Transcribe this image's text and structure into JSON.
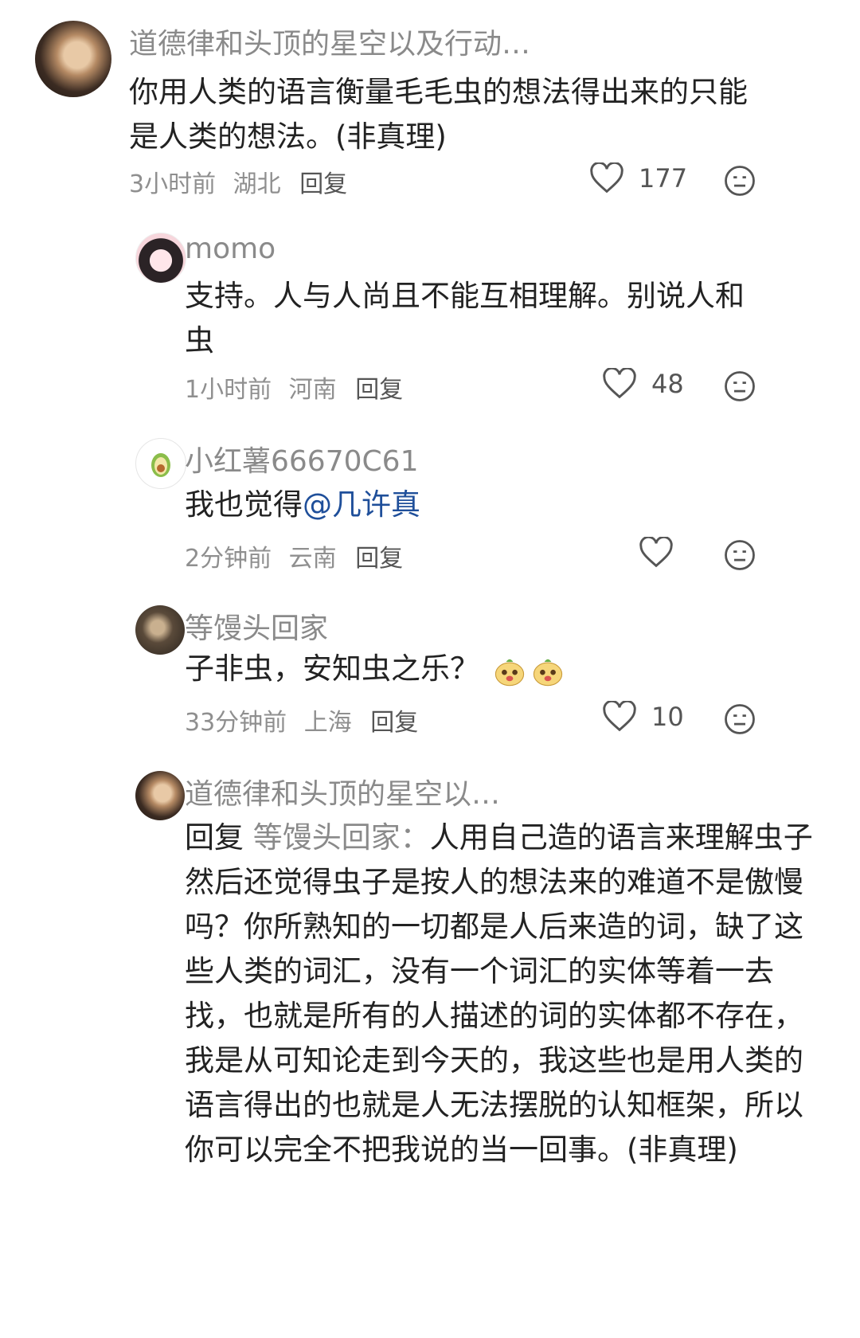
{
  "comments": [
    {
      "name": "道德律和头顶的星空以及行动…",
      "text": "你用人类的语言衡量毛毛虫的想法得出来的只能是人类的想法。(非真理)",
      "time": "3小时前",
      "location": "湖北",
      "reply": "回复",
      "likes": "177"
    },
    {
      "name": "momo",
      "text": "支持。人与人尚且不能互相理解。别说人和虫",
      "time": "1小时前",
      "location": "河南",
      "reply": "回复",
      "likes": "48"
    },
    {
      "name": "小红薯66670C61",
      "text": "我也觉得",
      "mention": "@几许真",
      "time": "2分钟前",
      "location": "云南",
      "reply": "回复",
      "likes": ""
    },
    {
      "name": "等馒头回家",
      "text": "子非虫，安知虫之乐？",
      "time": "33分钟前",
      "location": "上海",
      "reply": "回复",
      "likes": "10"
    },
    {
      "name": "道德律和头顶的星空以…",
      "reply_prefix": "回复",
      "reply_to": "等馒头回家：",
      "text": "人用自己造的语言来理解虫子然后还觉得虫子是按人的想法来的难道不是傲慢吗？你所熟知的一切都是人后来造的词，缺了这些人类的词汇，没有一个词汇的实体等着一去找，也就是所有的人描述的词的实体都不存在，我是从可知论走到今天的，我这些也是用人类的语言得出的也就是人无法摆脱的认知框架，所以你可以完全不把我说的当一回事。(非真理)"
    }
  ],
  "colors": {
    "name": "#8a8a8a",
    "mention": "#1f4f9a",
    "meta": "#8f8f8f"
  },
  "icons": [
    "heart-icon",
    "dislike-face-icon",
    "emoji-bun-icon"
  ]
}
